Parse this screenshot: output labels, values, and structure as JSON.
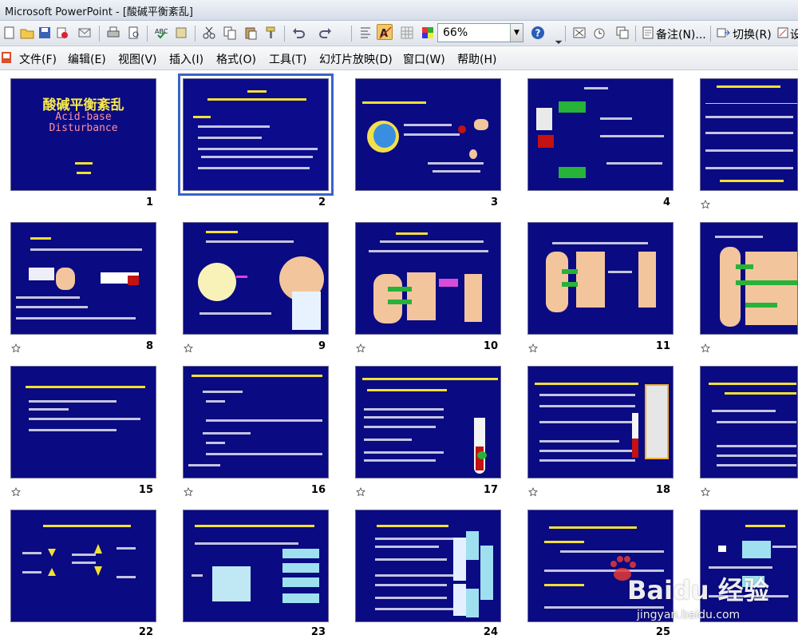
{
  "window": {
    "title": "Microsoft PowerPoint - [酸碱平衡紊乱]"
  },
  "toolbar": {
    "zoom": "66%",
    "notes_label": "备注(N)...",
    "switch_label": "切换(R)",
    "trailing_label": "设"
  },
  "menu": {
    "items": [
      "文件(F)",
      "编辑(E)",
      "视图(V)",
      "插入(I)",
      "格式(O)",
      "工具(T)",
      "幻灯片放映(D)",
      "窗口(W)",
      "帮助(H)"
    ]
  },
  "slide1": {
    "title": "酸碱平衡紊乱",
    "subtitle_line1": "Acid-base",
    "subtitle_line2": "Disturbance"
  },
  "slides": {
    "numbers": [
      "1",
      "2",
      "3",
      "4",
      "",
      "",
      "8",
      "9",
      "10",
      "11",
      "",
      "15",
      "16",
      "17",
      "18",
      "",
      "22",
      "23",
      "24",
      "25",
      ""
    ]
  },
  "watermark": {
    "brand": "Baidu 经验",
    "url": "jingyan.baidu.com"
  },
  "colors": {
    "slide_bg": "#0a0a82",
    "slide_title": "#f6e84a",
    "selection": "#3a63c8"
  }
}
